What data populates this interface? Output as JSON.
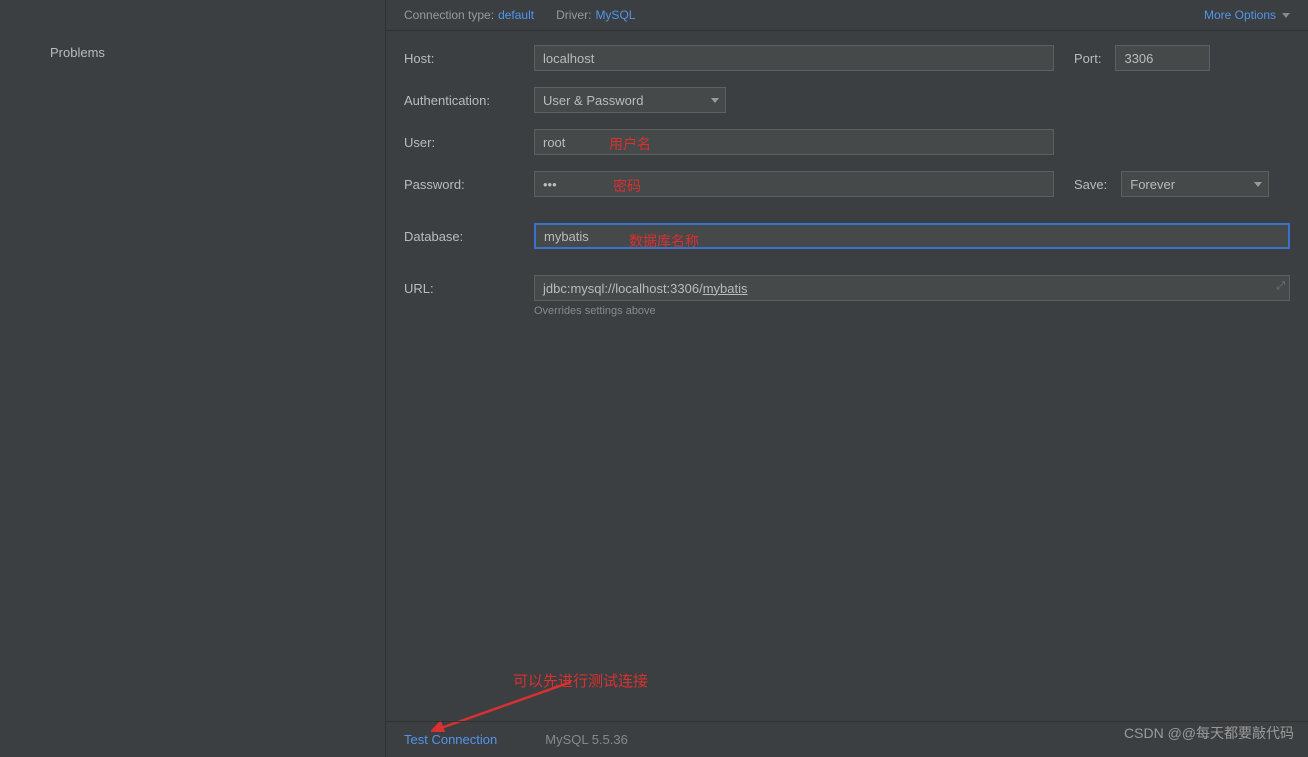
{
  "sidebar": {
    "problems": "Problems"
  },
  "topBar": {
    "connectionTypeLabel": "Connection type:",
    "connectionTypeValue": "default",
    "driverLabel": "Driver:",
    "driverValue": "MySQL",
    "moreOptions": "More Options"
  },
  "form": {
    "hostLabel": "Host:",
    "hostValue": "localhost",
    "portLabel": "Port:",
    "portValue": "3306",
    "authLabel": "Authentication:",
    "authValue": "User & Password",
    "userLabel": "User:",
    "userValue": "root",
    "passwordLabel": "Password:",
    "passwordValue": "•••",
    "saveLabel": "Save:",
    "saveValue": "Forever",
    "databaseLabel": "Database:",
    "databaseValue": "mybatis",
    "urlLabel": "URL:",
    "urlPrefix": "jdbc:mysql://localhost:3306/",
    "urlSuffix": "mybatis",
    "urlHint": "Overrides settings above"
  },
  "annotations": {
    "user": "用户名",
    "password": "密码",
    "database": "数据库名称",
    "testConnection": "可以先进行测试连接"
  },
  "bottomBar": {
    "testConnection": "Test Connection",
    "driverVersion": "MySQL 5.5.36"
  },
  "watermark": "CSDN @@每天都要敲代码"
}
